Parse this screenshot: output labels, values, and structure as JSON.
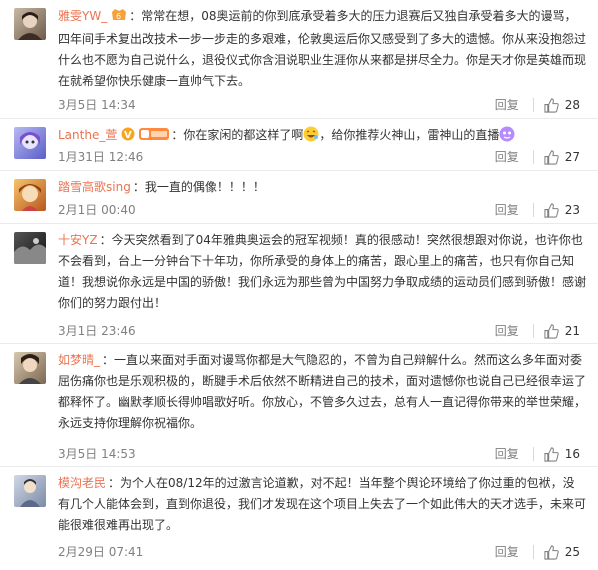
{
  "comments": [
    {
      "user": "雅雯YW_",
      "text": "：常常在想，08奥运前的你到底承受着多大的压力退赛后又独自承受着多大的谩骂，四年间手术复出改技术一步一步走的多艰难，伦敦奥运后你又感受到了多大的遗憾。你从来没抱怨过什么也不愿为自己说什么，退役仪式你含泪说职业生涯你从来都是拼尽全力。你是天才你是英雄而现在就希望你快乐健康一直帅气下去。",
      "time": "3月5日 14:34",
      "reply": "回复",
      "likes": "28"
    },
    {
      "user": "Lanthe_萱",
      "text": "：你在家闲的都这样了啊",
      "text2": "，给你推荐火神山，雷神山的直播",
      "time": "1月31日 12:46",
      "reply": "回复",
      "likes": "27"
    },
    {
      "user": "踏雪高歌sing",
      "text": "：我一直的偶像！！！！",
      "time": "2月1日 00:40",
      "reply": "回复",
      "likes": "23"
    },
    {
      "user": "十安YZ",
      "text": "：今天突然看到了04年雅典奥运会的冠军视频！真的很感动！突然很想跟对你说，也许你也不会看到，台上一分钟台下十年功，你所承受的身体上的痛苦，跟心里上的痛苦，也只有你自己知道！我想说你永远是中国的骄傲！我们永远为那些曾为中国努力争取成绩的运动员们感到骄傲！感谢你们的努力跟付出！",
      "time": "3月1日 23:46",
      "reply": "回复",
      "likes": "21"
    },
    {
      "user": "如梦晴_",
      "text": "：一直以来面对手面对谩骂你都是大气隐忍的，不曾为自己辩解什么。然而这么多年面对委屈伤痛你也是乐观积极的，断腱手术后依然不断精进自己的技术，面对遗憾你也说自己已经很幸运了都释怀了。幽默孝顺长得帅唱歌好听。你放心，不管多久过去，总有人一直记得你带来的举世荣耀，永远支持你理解你祝福你。",
      "time": "3月5日 14:53",
      "reply": "回复",
      "likes": "16"
    },
    {
      "user": "模沟老民",
      "text": "：为个人在08/12年的过激言论道歉，对不起！当年整个舆论环境给了你过重的包袱，没有几个人能体会到，直到你退役，我们才发现在这个项目上失去了一个如此伟大的天才选手，未来可能很难很难再出现了。",
      "time": "2月29日 07:41",
      "reply": "回复",
      "likes": "25"
    }
  ]
}
